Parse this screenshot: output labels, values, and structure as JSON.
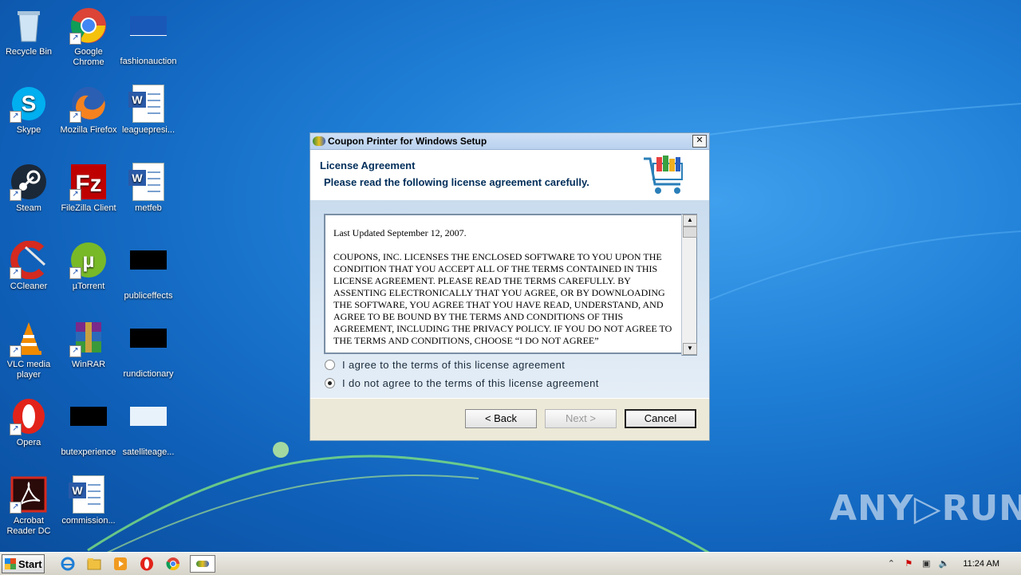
{
  "desktop": {
    "icons": [
      {
        "label": "Recycle Bin"
      },
      {
        "label": "Google Chrome"
      },
      {
        "label": "fashionauction"
      },
      {
        "label": "Skype"
      },
      {
        "label": "Mozilla Firefox"
      },
      {
        "label": "leaguepresi..."
      },
      {
        "label": "Steam"
      },
      {
        "label": "FileZilla Client"
      },
      {
        "label": "metfeb"
      },
      {
        "label": "CCleaner"
      },
      {
        "label": "µTorrent"
      },
      {
        "label": "publiceffects"
      },
      {
        "label": "VLC media player"
      },
      {
        "label": "WinRAR"
      },
      {
        "label": "rundictionary"
      },
      {
        "label": "Opera"
      },
      {
        "label": "butexperience"
      },
      {
        "label": "satelliteage..."
      },
      {
        "label": "Acrobat Reader DC"
      },
      {
        "label": "commission..."
      }
    ]
  },
  "dialog": {
    "title": "Coupon Printer for Windows Setup",
    "close_label": "✕",
    "header_title": "License Agreement",
    "header_subtitle": "Please read the following license agreement carefully.",
    "license_paragraphs": [
      "Last Updated September 12, 2007.",
      "COUPONS, INC. LICENSES THE ENCLOSED SOFTWARE TO YOU UPON THE CONDITION THAT YOU ACCEPT ALL OF THE TERMS CONTAINED IN THIS LICENSE AGREEMENT. PLEASE READ THE TERMS CAREFULLY. BY ASSENTING ELECTRONICALLY THAT YOU AGREE, OR BY DOWNLOADING THE SOFTWARE, YOU AGREE THAT YOU HAVE READ, UNDERSTAND, AND AGREE TO BE BOUND BY THE TERMS AND CONDITIONS OF THIS AGREEMENT, INCLUDING THE PRIVACY POLICY. IF YOU DO NOT AGREE TO THE TERMS AND CONDITIONS, CHOOSE “I DO NOT AGREE”"
    ],
    "radio_agree": "I agree to the terms of this license agreement",
    "radio_disagree": "I do not agree to the terms of this license agreement",
    "selected": "disagree",
    "back_label": "< Back",
    "next_label": "Next >",
    "cancel_label": "Cancel"
  },
  "watermark": "ANY▷RUN",
  "taskbar": {
    "start_label": "Start",
    "clock": "11:24 AM"
  },
  "colors": {
    "desktop_bg": "#1f7fd6",
    "header_text": "#002e5a",
    "dialog_face": "#ece9d8"
  }
}
